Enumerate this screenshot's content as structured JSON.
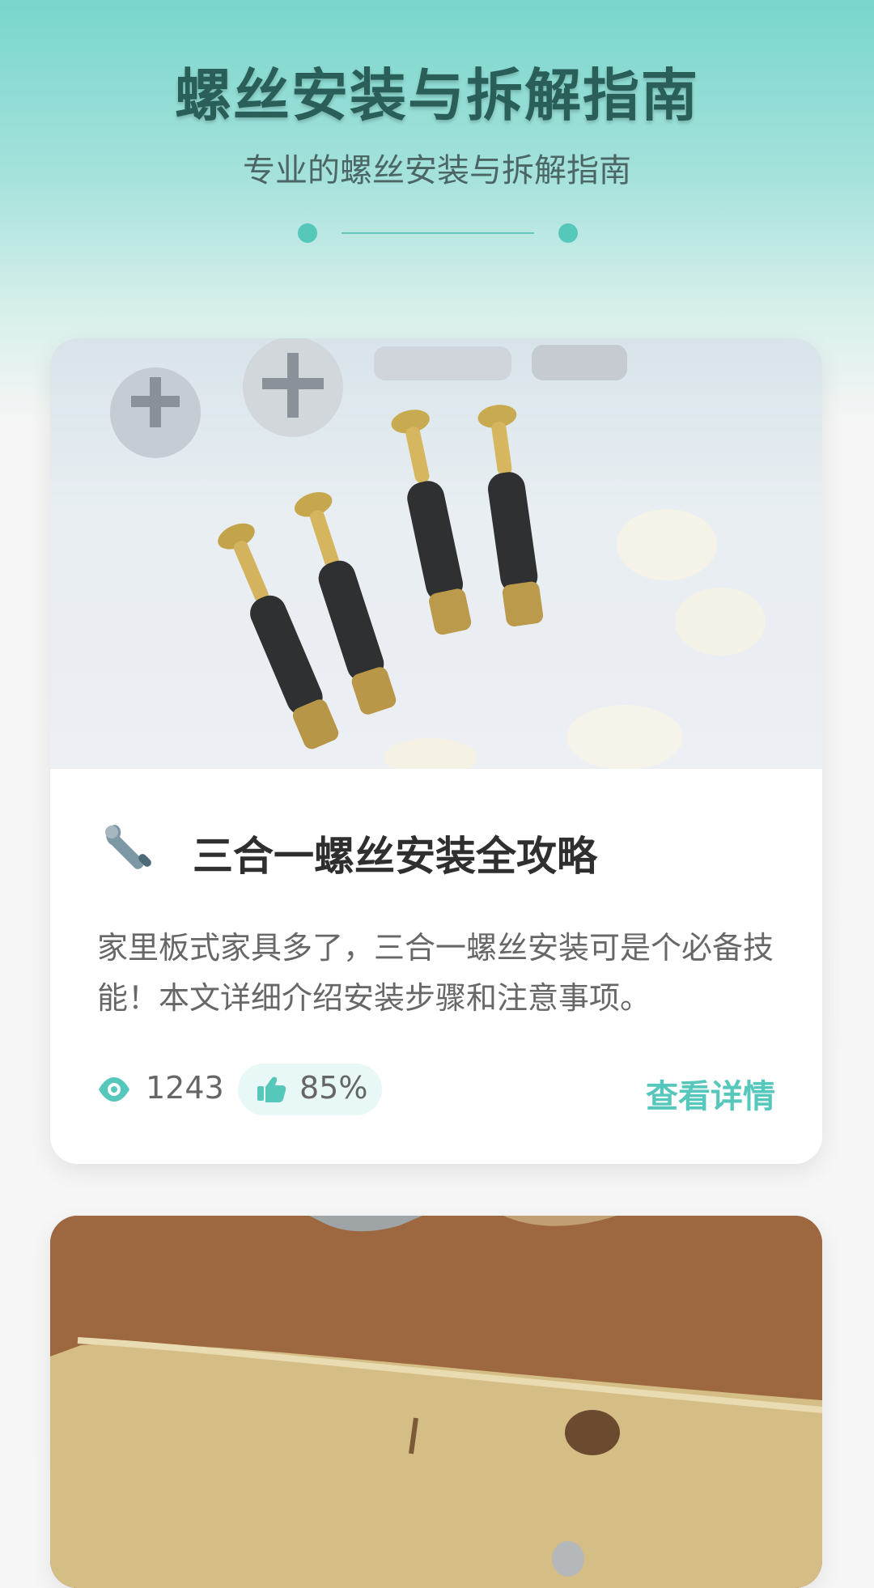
{
  "header": {
    "title": "螺丝安装与拆解指南",
    "subtitle": "专业的螺丝安装与拆解指南"
  },
  "cards": [
    {
      "title": "三合一螺丝安装全攻略",
      "description": "家里板式家具多了，三合一螺丝安装可是个必备技能！本文详细介绍安装步骤和注意事项。",
      "views": "1243",
      "likes": "85%",
      "detail_label": "查看详情",
      "title_icon": "wrench-icon"
    },
    {
      "title": "",
      "description": ""
    }
  ],
  "colors": {
    "accent": "#56c7bb",
    "title": "#2a5e58",
    "text": "#676767",
    "background": "#f7f6f6"
  }
}
